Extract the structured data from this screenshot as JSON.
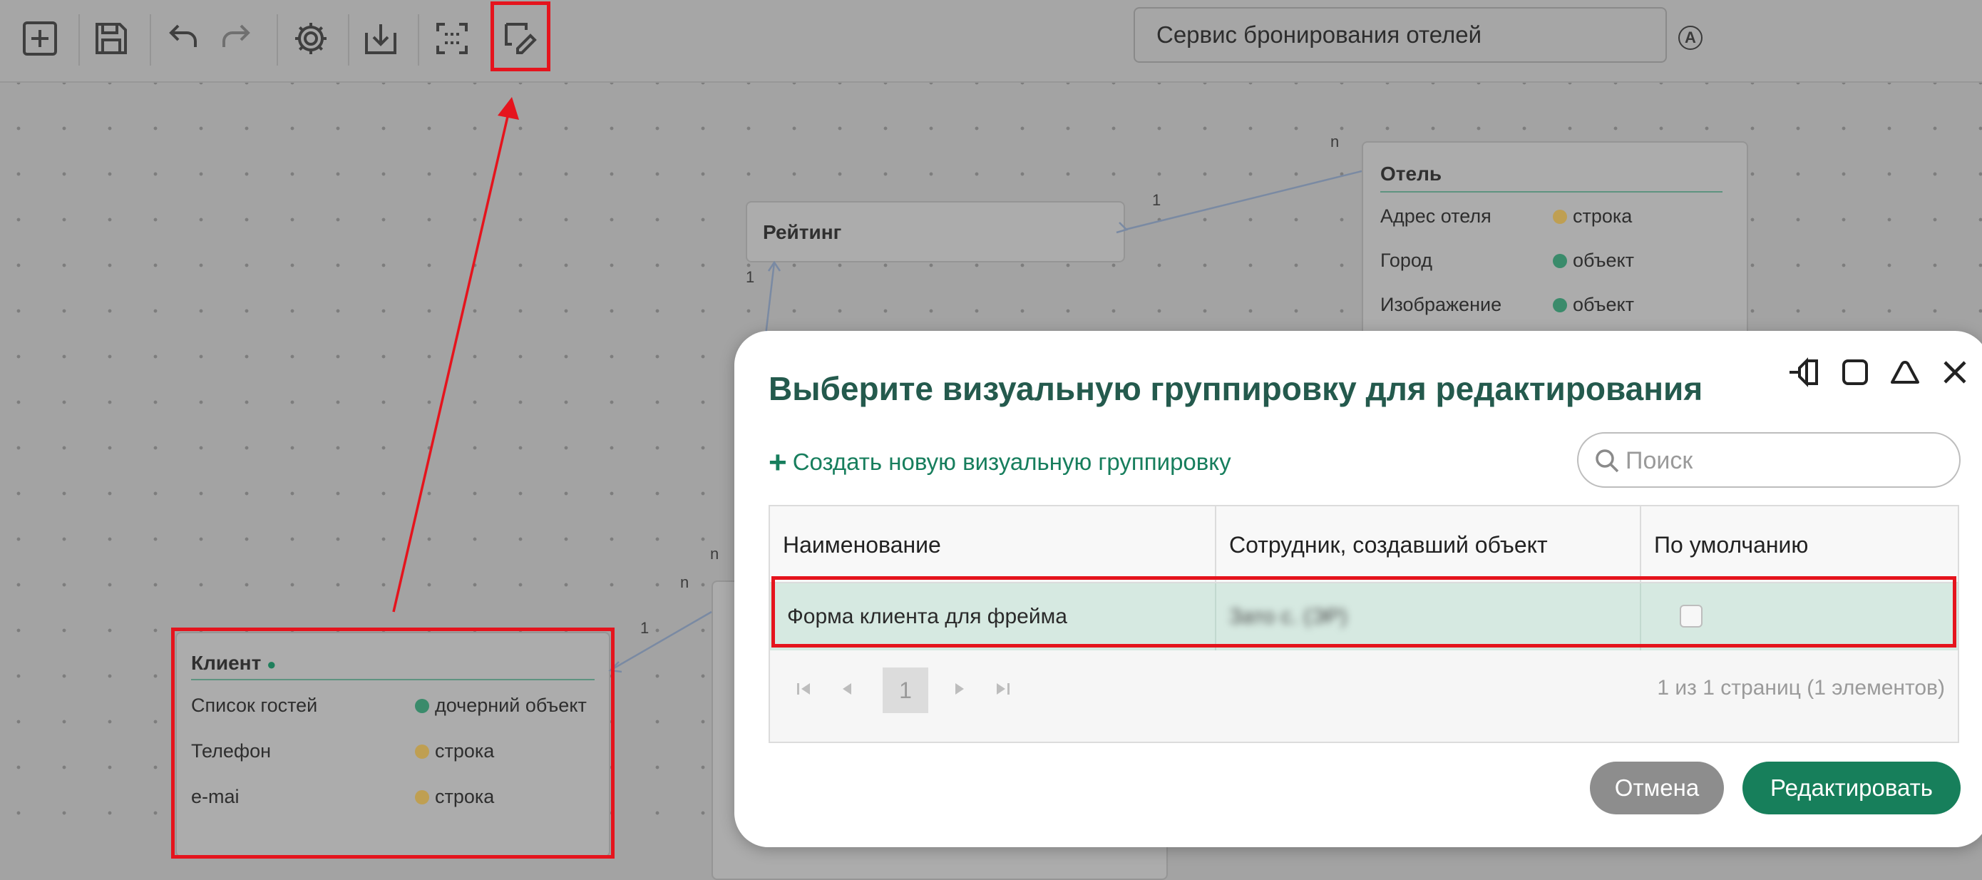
{
  "toolbar": {
    "buttons": [
      {
        "icon": "plus-square-icon"
      },
      {
        "icon": "save-icon"
      },
      {
        "icon": "undo-icon"
      },
      {
        "icon": "redo-icon"
      },
      {
        "icon": "gear-icon"
      },
      {
        "icon": "download-icon"
      },
      {
        "icon": "focus-icon"
      },
      {
        "icon": "edit-grouping-icon"
      }
    ],
    "project_title": "Сервис бронирования отелей",
    "lang_badge": "A"
  },
  "canvas": {
    "entities": {
      "rating": {
        "title": "Рейтинг"
      },
      "hotel": {
        "title": "Отель",
        "fields": [
          {
            "name": "Адрес отеля",
            "type": "строка",
            "color": "#bf9f52"
          },
          {
            "name": "Город",
            "type": "объект",
            "color": "#3a8b6b"
          },
          {
            "name": "Изображение",
            "type": "объект",
            "color": "#3a8b6b"
          }
        ]
      },
      "client": {
        "title": "Клиент",
        "fields": [
          {
            "name": "Список гостей",
            "type": "дочерний объект",
            "color": "#3a8b6b"
          },
          {
            "name": "Телефон",
            "type": "строка",
            "color": "#bf9f52"
          },
          {
            "name": "e-mai",
            "type": "строка",
            "color": "#bf9f52"
          }
        ]
      }
    },
    "multiplicities": {
      "hotel_n": "n",
      "rating_1a": "1",
      "rating_1b": "1",
      "mid_n1": "n",
      "mid_n2": "n",
      "client_1": "1"
    }
  },
  "modal": {
    "title": "Выберите визуальную группировку для редактирования",
    "create_link": "Создать новую визуальную группировку",
    "search_placeholder": "Поиск",
    "columns": [
      "Наименование",
      "Сотрудник, создавший объект",
      "По умолчанию"
    ],
    "rows": [
      {
        "name": "Форма клиента для фрейма",
        "author": "Зато с. (ЭР)",
        "default": false
      }
    ],
    "pager": {
      "current_page": "1",
      "info": "1 из 1 страниц (1 элементов)"
    },
    "cancel_label": "Отмена",
    "edit_label": "Редактировать"
  },
  "colors": {
    "accent": "#177f5b",
    "highlight": "#e5141d",
    "title": "#245a4d"
  }
}
